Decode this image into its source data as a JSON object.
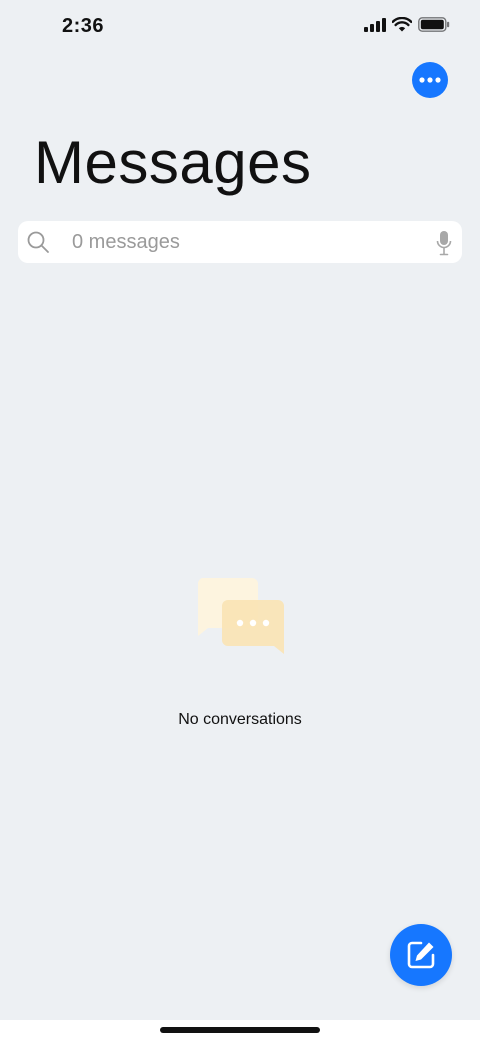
{
  "status_bar": {
    "time": "2:36",
    "icons": [
      "signal-icon",
      "wifi-icon",
      "battery-icon"
    ]
  },
  "header": {
    "more_icon": "more-icon",
    "title": "Messages"
  },
  "search": {
    "placeholder": "0 messages",
    "value": "",
    "icon": "search-icon",
    "mic_icon": "mic-icon"
  },
  "empty_state": {
    "icon": "chat-bubbles-icon",
    "text": "No conversations"
  },
  "compose": {
    "icon": "compose-icon"
  },
  "colors": {
    "accent": "#1677ff",
    "background": "#edf0f3",
    "empty_icon_back": "#fdf4df",
    "empty_icon_front": "#f9e3b4"
  }
}
